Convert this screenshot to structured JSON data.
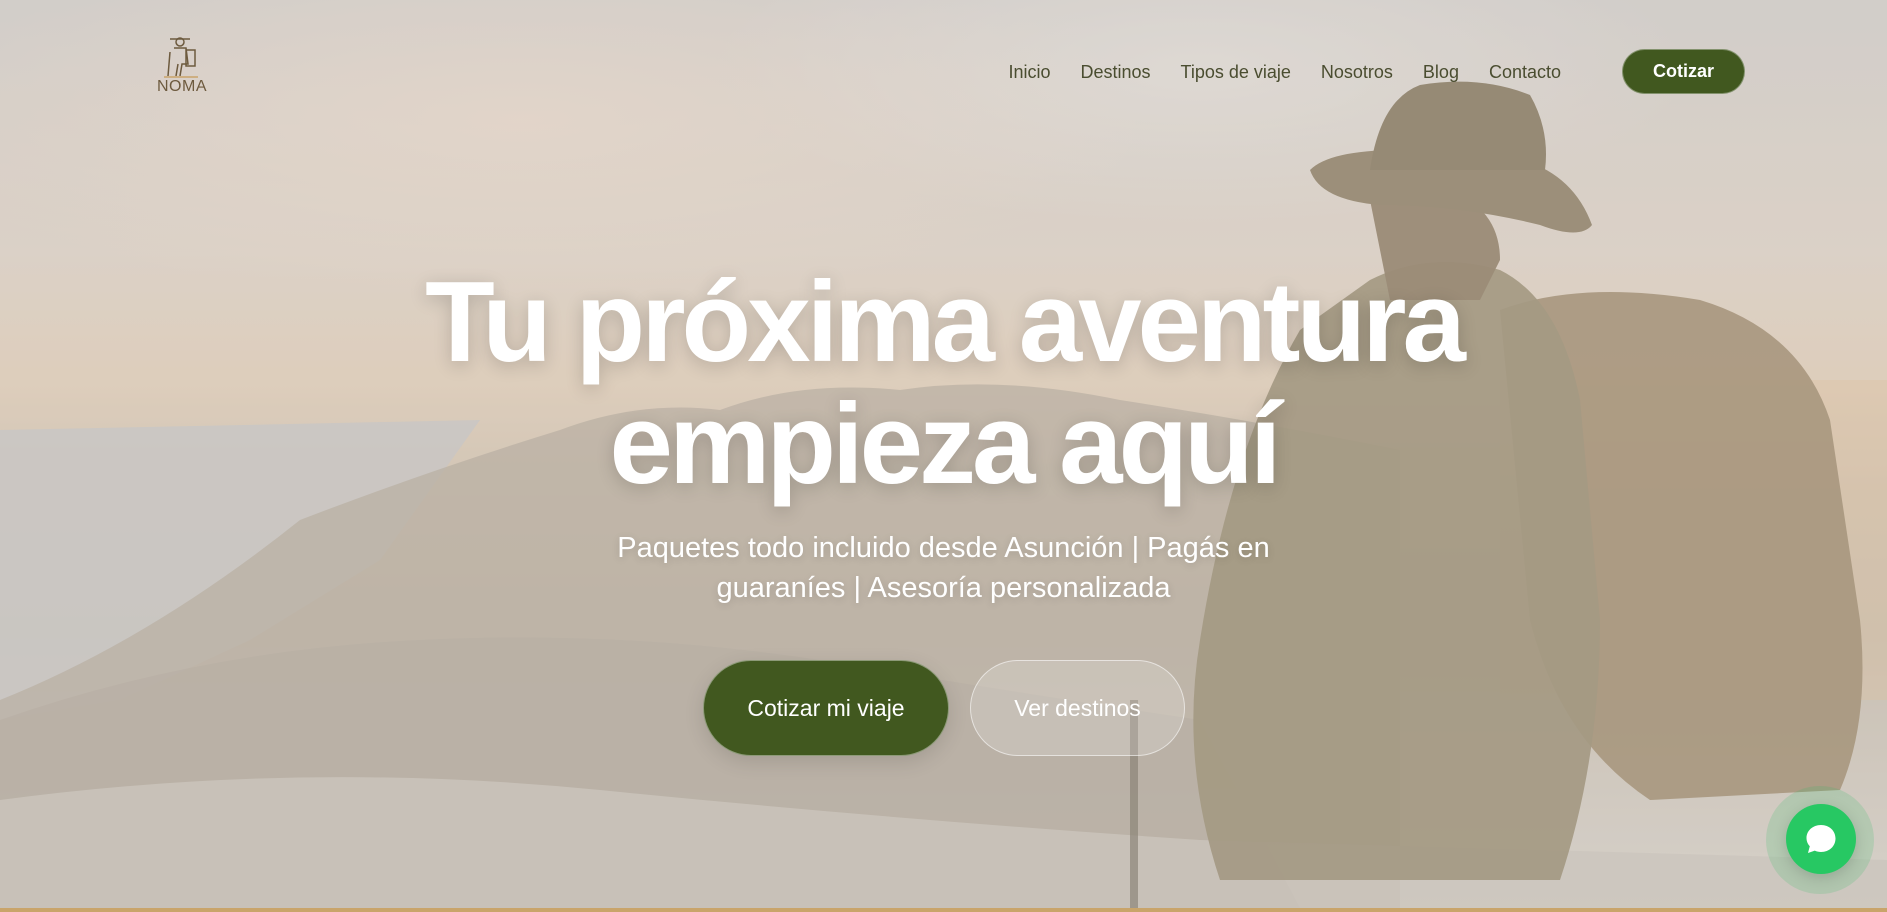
{
  "brand": {
    "name": "NOMA",
    "logo_icon": "hiker-logo-icon"
  },
  "nav": {
    "items": [
      "Inicio",
      "Destinos",
      "Tipos de viaje",
      "Nosotros",
      "Blog",
      "Contacto"
    ],
    "cta_label": "Cotizar"
  },
  "hero": {
    "title_line1": "Tu próxima aventura",
    "title_line2": "empieza aquí",
    "subtitle": "Paquetes todo incluido desde Asunción | Pagás en guaraníes | Asesoría personalizada",
    "primary_button": "Cotizar mi viaje",
    "secondary_button": "Ver destinos"
  },
  "floating": {
    "chat_icon": "chat-bubble-icon"
  },
  "colors": {
    "accent_green": "#41581f",
    "whatsapp_green": "#27c863",
    "gold_stripe": "#c9a46a"
  }
}
